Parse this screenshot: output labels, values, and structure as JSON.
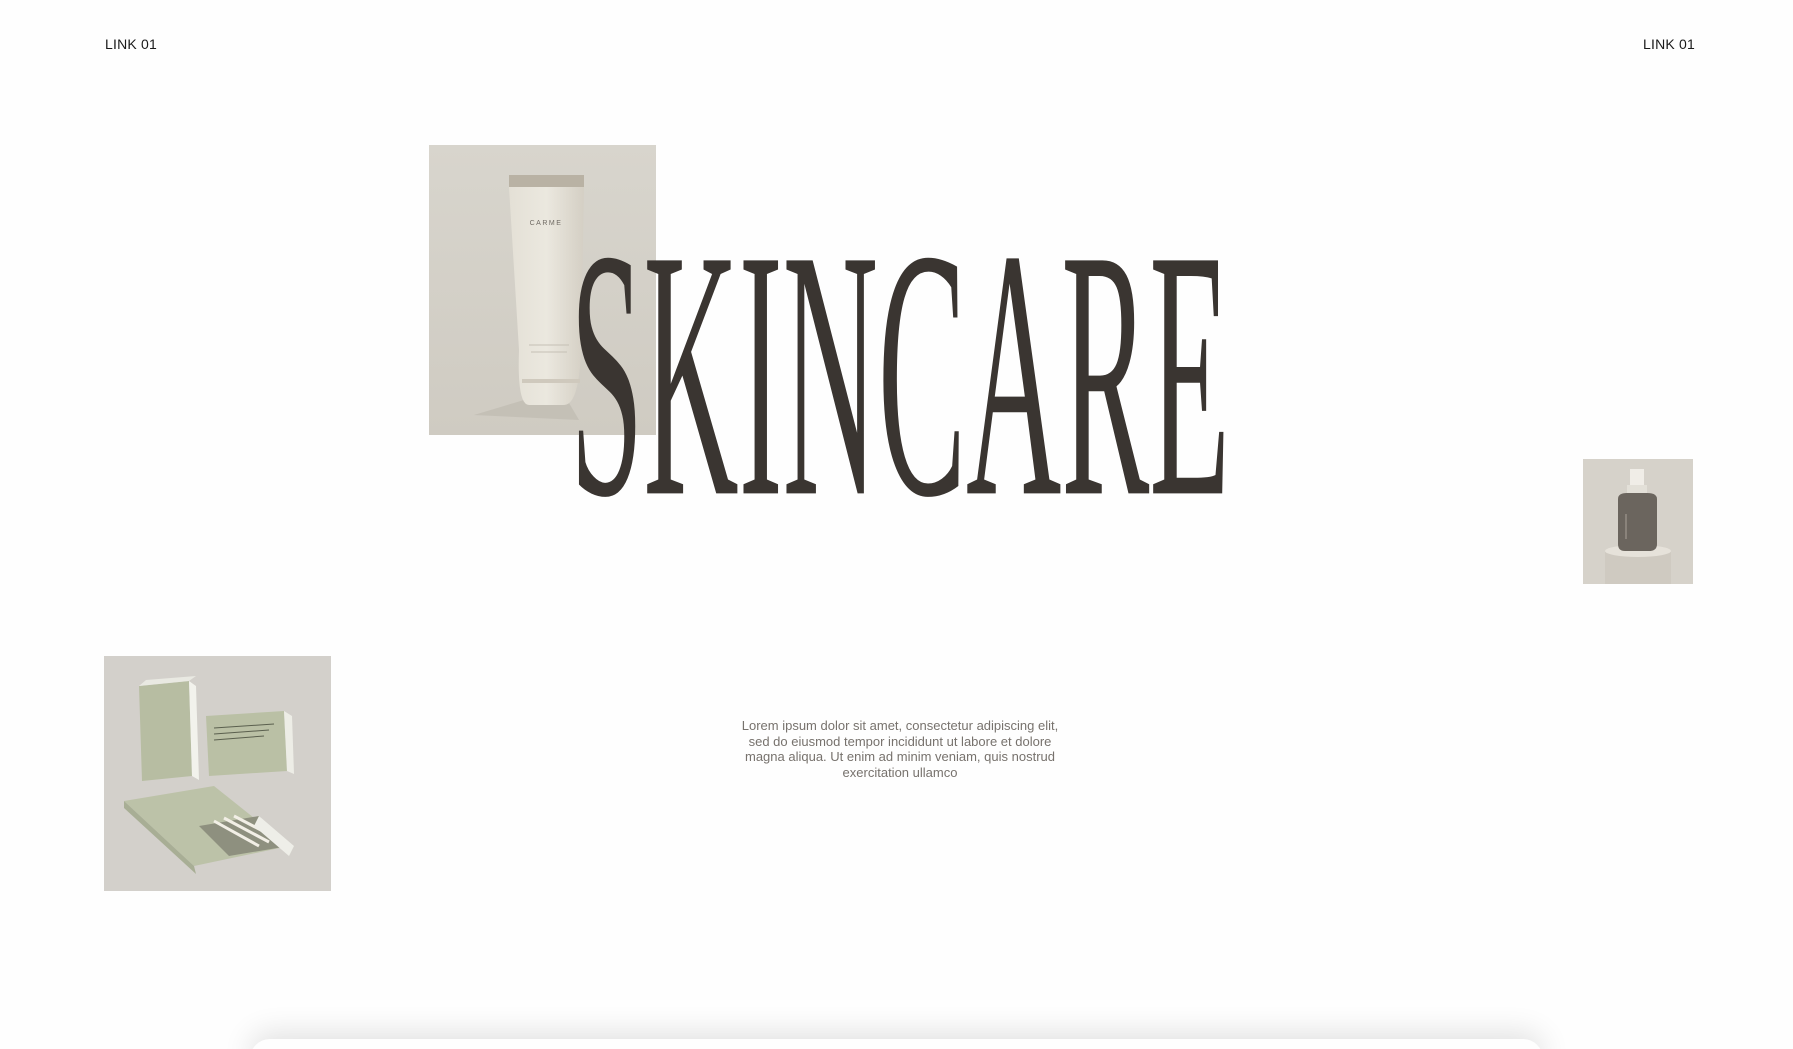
{
  "nav": {
    "left_link": "LINK 01",
    "right_link": "LINK 01"
  },
  "hero": {
    "title": "SKINCARE",
    "description": "Lorem ipsum dolor sit amet, consectetur adipiscing elit, sed do eiusmod tempor incididunt ut labore et dolore magna aliqua. Ut enim ad minim veniam, quis nostrud exercitation ullamco"
  },
  "products": {
    "tube_brand": "CARME"
  },
  "colors": {
    "background": "#fefefe",
    "title": "#3a3531",
    "body_text": "#77726d",
    "photo_bg": "#d9d6cf",
    "sage": "#b9bfa6"
  }
}
